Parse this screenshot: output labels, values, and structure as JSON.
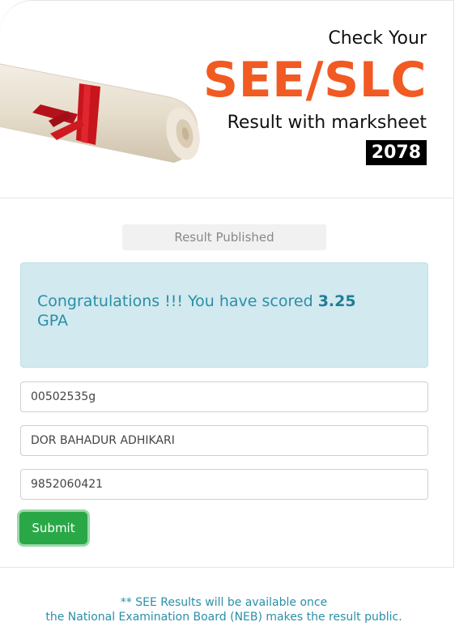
{
  "header": {
    "line1": "Check Your",
    "line2": "SEE/SLC",
    "line3": "Result with marksheet",
    "year": "2078"
  },
  "status": {
    "label": "Result Published"
  },
  "alert": {
    "prefix": "Congratulations !!! You have scored ",
    "gpa": "3.25",
    "suffix": "GPA"
  },
  "form": {
    "symbol_no": "00502535g",
    "name": "DOR BAHADUR ADHIKARI",
    "phone": "9852060421",
    "submit_label": "Submit"
  },
  "footer": {
    "line1": "** SEE Results will be available once",
    "line2": "the National Examination Board (NEB) makes the result public."
  },
  "colors": {
    "accent_orange": "#f15a22",
    "alert_bg": "#d1e9ef",
    "alert_text": "#2a8fa7",
    "submit_green": "#2aa847"
  },
  "icons": {
    "hero_image": "diploma-scroll-icon"
  }
}
